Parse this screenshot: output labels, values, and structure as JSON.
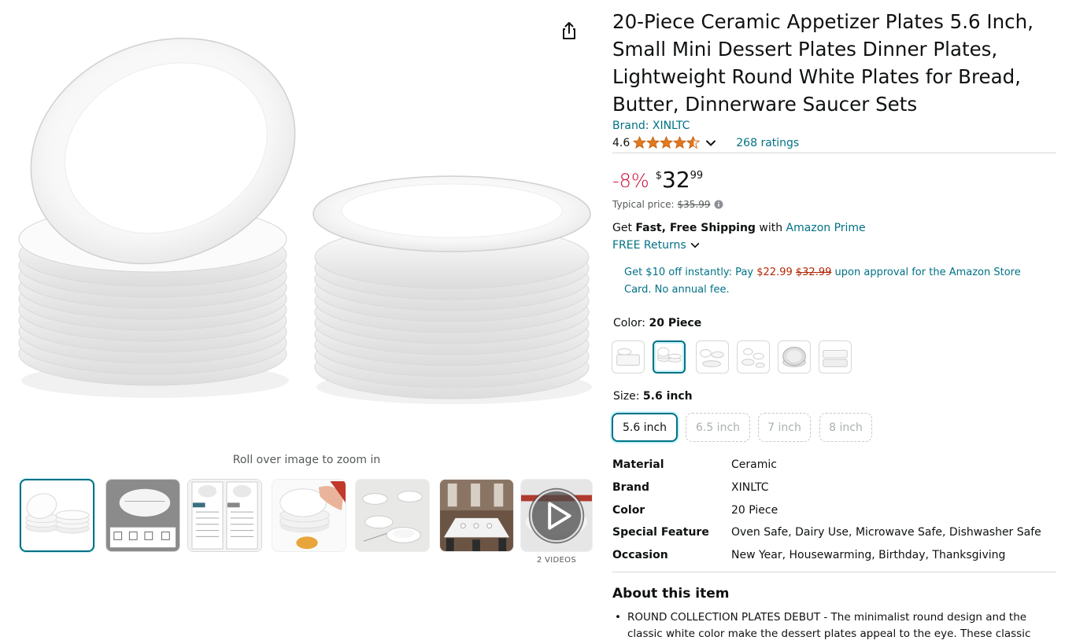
{
  "gallery": {
    "zoom_hint": "Roll over image to zoom in",
    "videos_label": "2 VIDEOS",
    "thumbnails": [
      "plates-stack",
      "plate-size",
      "comparison-chart",
      "hand-holding-plates",
      "table-setting",
      "dining-room",
      "video"
    ],
    "selected_index": 0
  },
  "product": {
    "title": "20-Piece Ceramic Appetizer Plates 5.6 Inch, Small Mini Dessert Plates Dinner Plates, Lightweight Round White Plates for Bread, Butter, Dinnerware Saucer Sets",
    "brand_link": "Brand: XINLTC",
    "rating": "4.6",
    "rating_stars": 4.6,
    "ratings_count": "268 ratings"
  },
  "price": {
    "discount": "-8%",
    "currency": "$",
    "whole": "32",
    "fraction": "99",
    "typical_label": "Typical price:",
    "typical_value": "$35.99"
  },
  "shipping": {
    "get": "Get",
    "bold": "Fast, Free Shipping",
    "with": "with",
    "prime_link": "Amazon Prime",
    "returns": "FREE Returns"
  },
  "promo": {
    "part1": "Get $10 off instantly: Pay",
    "new_price": "$22.99",
    "old_price": "$32.99",
    "part2": "upon approval for the Amazon Store Card. No annual fee."
  },
  "color": {
    "label": "Color:",
    "selected": "20 Piece",
    "swatches": [
      "plates-set-a",
      "20-piece",
      "plates-set-c",
      "plates-set-d",
      "plates-set-e",
      "plates-set-f"
    ]
  },
  "size": {
    "label": "Size:",
    "selected": "5.6 inch",
    "options": [
      "5.6 inch",
      "6.5 inch",
      "7 inch",
      "8 inch"
    ]
  },
  "specs": [
    {
      "label": "Material",
      "value": "Ceramic"
    },
    {
      "label": "Brand",
      "value": "XINLTC"
    },
    {
      "label": "Color",
      "value": "20 Piece"
    },
    {
      "label": "Special Feature",
      "value": "Oven Safe, Dairy Use, Microwave Safe, Dishwasher Safe"
    },
    {
      "label": "Occasion",
      "value": "New Year, Housewarming, Birthday, Thanksgiving"
    }
  ],
  "about": {
    "heading": "About this item",
    "bullets": [
      "ROUND COLLECTION PLATES DEBUT - The minimalist round design and the classic white color make the dessert plates appeal to the eye. These classic"
    ]
  },
  "colors": {
    "link": "#007185",
    "deal_red": "#cc0c39",
    "price_red": "#b12704",
    "star": "#de7921",
    "selected_border": "#007185"
  }
}
